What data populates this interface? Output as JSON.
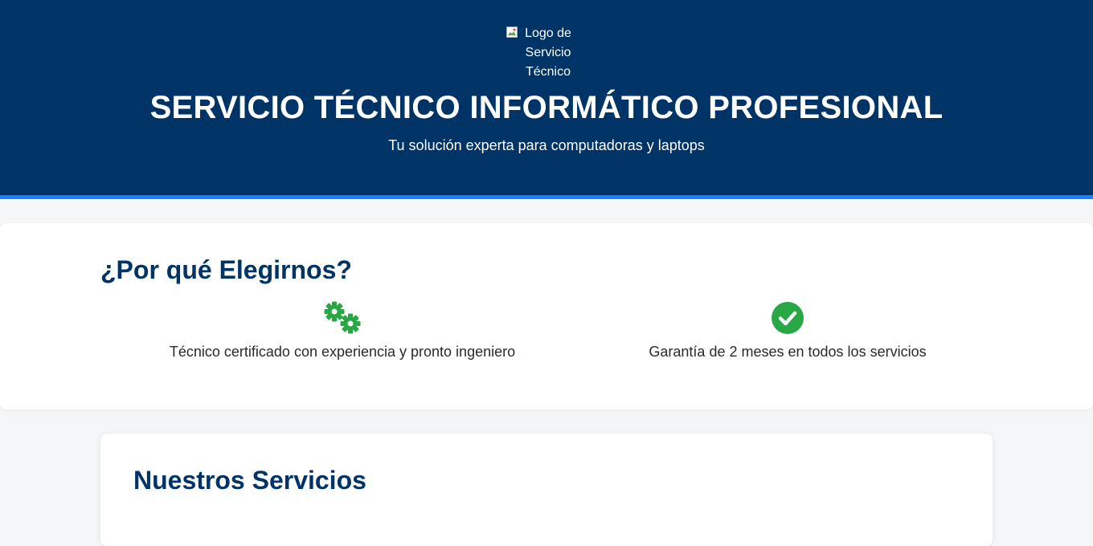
{
  "header": {
    "logo_alt": "Logo de Servicio Técnico",
    "title": "SERVICIO TÉCNICO INFORMÁTICO PROFESIONAL",
    "subtitle": "Tu solución experta para computadoras y laptops"
  },
  "why": {
    "heading": "¿Por qué Elegirnos?",
    "features": [
      {
        "icon": "gears-icon",
        "text": "Técnico certificado con experiencia y pronto ingeniero"
      },
      {
        "icon": "check-circle-icon",
        "text": "Garantía de 2 meses en todos los servicios"
      }
    ]
  },
  "services": {
    "heading": "Nuestros Servicios"
  },
  "colors": {
    "header_bg": "#003366",
    "header_border": "#1a7fff",
    "heading": "#003366",
    "icon_green": "#28a745"
  }
}
